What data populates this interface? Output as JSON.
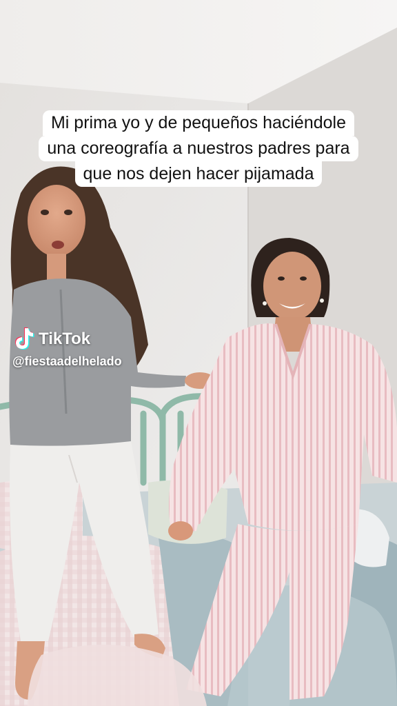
{
  "caption": {
    "lines": [
      "Mi prima yo y de pequeños haciéndole",
      "una coreografía a nuestros padres para",
      "que nos dejen hacer pijamada"
    ]
  },
  "watermark": {
    "brand": "TikTok",
    "handle": "@fiestaadelhelado",
    "icon": "tiktok-logo-icon"
  },
  "colors": {
    "caption_bg": "#ffffff",
    "caption_text": "#111111",
    "watermark_text": "#ffffff",
    "wall": "#e9e7e5",
    "grey_top": "#9a9c9f",
    "pink_pajamas": "#f3d9dc",
    "headboard": "#8fb9a8"
  }
}
